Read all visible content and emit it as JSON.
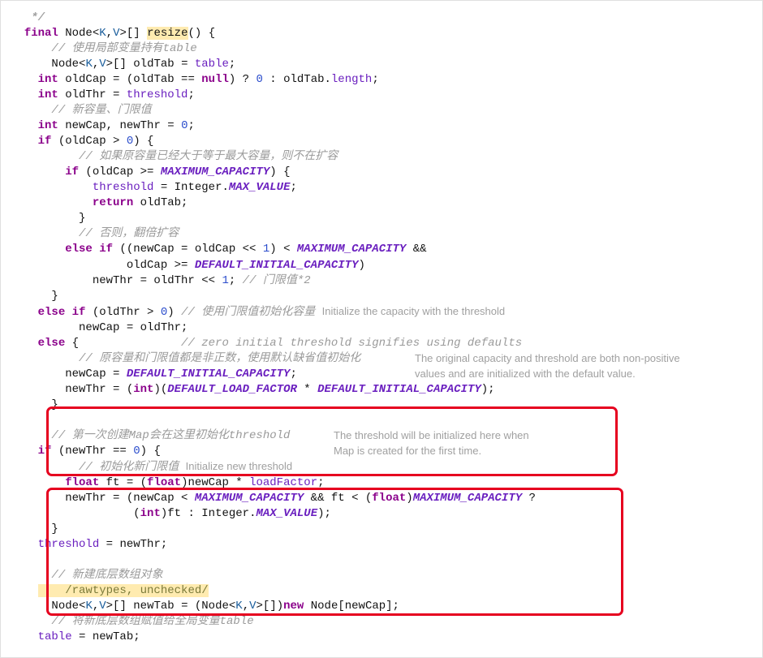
{
  "code": {
    "l00": "   */",
    "l01_a": "final",
    "l01_b": " Node<",
    "l01_c": "K",
    "l01_d": ",",
    "l01_e": "V",
    "l01_f": ">[] ",
    "l01_g": "resize",
    "l01_h": "() {",
    "l02": "    // 使用局部变量持有table",
    "l03_a": "    Node<",
    "l03_b": "K",
    "l03_c": ",",
    "l03_d": "V",
    "l03_e": ">[] oldTab = ",
    "l03_f": "table",
    "l03_g": ";",
    "l04_a": "    ",
    "l04_b": "int",
    "l04_c": " oldCap = (oldTab == ",
    "l04_d": "null",
    "l04_e": ") ? ",
    "l04_f": "0",
    "l04_g": " : oldTab.",
    "l04_h": "length",
    "l04_i": ";",
    "l05_a": "    ",
    "l05_b": "int",
    "l05_c": " oldThr = ",
    "l05_d": "threshold",
    "l05_e": ";",
    "l06": "    // 新容量、门限值",
    "l07_a": "    ",
    "l07_b": "int",
    "l07_c": " newCap, newThr = ",
    "l07_d": "0",
    "l07_e": ";",
    "l08_a": "    ",
    "l08_b": "if",
    "l08_c": " (oldCap > ",
    "l08_d": "0",
    "l08_e": ") {",
    "l09": "        // 如果原容量已经大于等于最大容量，则不在扩容",
    "l10_a": "        ",
    "l10_b": "if",
    "l10_c": " (oldCap >= ",
    "l10_d": "MAXIMUM_CAPACITY",
    "l10_e": ") {",
    "l11_a": "            ",
    "l11_b": "threshold",
    "l11_c": " = Integer.",
    "l11_d": "MAX_VALUE",
    "l11_e": ";",
    "l12_a": "            ",
    "l12_b": "return",
    "l12_c": " oldTab;",
    "l13": "        }",
    "l14": "        // 否则，翻倍扩容",
    "l15_a": "        ",
    "l15_b": "else if",
    "l15_c": " ((newCap = oldCap << ",
    "l15_d": "1",
    "l15_e": ") < ",
    "l15_f": "MAXIMUM_CAPACITY",
    "l15_g": " &&",
    "l16_a": "                 oldCap >= ",
    "l16_b": "DEFAULT_INITIAL_CAPACITY",
    "l16_c": ")",
    "l17_a": "            newThr = oldThr << ",
    "l17_b": "1",
    "l17_c": "; ",
    "l17_d": "// 门限值*2",
    "l18": "    }",
    "l19_a": "    ",
    "l19_b": "else if",
    "l19_c": " (oldThr > ",
    "l19_d": "0",
    "l19_e": ") ",
    "l19_f": "// 使用门限值初始化容量 ",
    "l19_ann": "Initialize the capacity with the threshold",
    "l20": "        newCap = oldThr;",
    "l21_a": "    ",
    "l21_b": "else",
    "l21_c": " {               ",
    "l21_d": "// zero initial threshold signifies using defaults",
    "l22": "        // 原容量和门限值都是非正数，使用默认缺省值初始化",
    "l22_ann1": "The original capacity and threshold are both non-positive",
    "l22_ann2": "values and are initialized with the default value.",
    "l23_a": "        newCap = ",
    "l23_b": "DEFAULT_INITIAL_CAPACITY",
    "l23_c": ";",
    "l24_a": "        newThr = (",
    "l24_b": "int",
    "l24_c": ")(",
    "l24_d": "DEFAULT_LOAD_FACTOR",
    "l24_e": " * ",
    "l24_f": "DEFAULT_INITIAL_CAPACITY",
    "l24_g": ");",
    "l25": "    }",
    "l26": "    // 第一次创建Map会在这里初始化threshold",
    "l26_ann1": "The threshold will be initialized here when",
    "l26_ann2": "Map is created for the first time.",
    "l27_a": "    ",
    "l27_b": "if",
    "l27_c": " (newThr == ",
    "l27_d": "0",
    "l27_e": ") {",
    "l28": "        // 初始化新门限值 ",
    "l28_ann": "Initialize new threshold",
    "l29_a": "        ",
    "l29_b": "float",
    "l29_c": " ft = (",
    "l29_d": "float",
    "l29_e": ")newCap * ",
    "l29_f": "loadFactor",
    "l29_g": ";",
    "l30_a": "        newThr = (newCap < ",
    "l30_b": "MAXIMUM_CAPACITY",
    "l30_c": " && ft < (",
    "l30_d": "float",
    "l30_e": ")",
    "l30_f": "MAXIMUM_CAPACITY",
    "l30_g": " ?",
    "l31_a": "                  (",
    "l31_b": "int",
    "l31_c": ")ft : Integer.",
    "l31_d": "MAX_VALUE",
    "l31_e": ");",
    "l32": "    }",
    "l33_a": "    ",
    "l33_b": "threshold",
    "l33_c": " = newThr;",
    "l34": "    // 新建底层数组对象",
    "l35": "    /rawtypes, unchecked/",
    "l36_a": "    Node<",
    "l36_b": "K",
    "l36_c": ",",
    "l36_d": "V",
    "l36_e": ">[] newTab = (Node<",
    "l36_f": "K",
    "l36_g": ",",
    "l36_h": "V",
    "l36_i": ">[])",
    "l36_j": "new",
    "l36_k": " Node[newCap];",
    "l37": "    // 将新底层数组赋值给全局变量table",
    "l38_a": "    ",
    "l38_b": "table",
    "l38_c": " = newTab;"
  }
}
